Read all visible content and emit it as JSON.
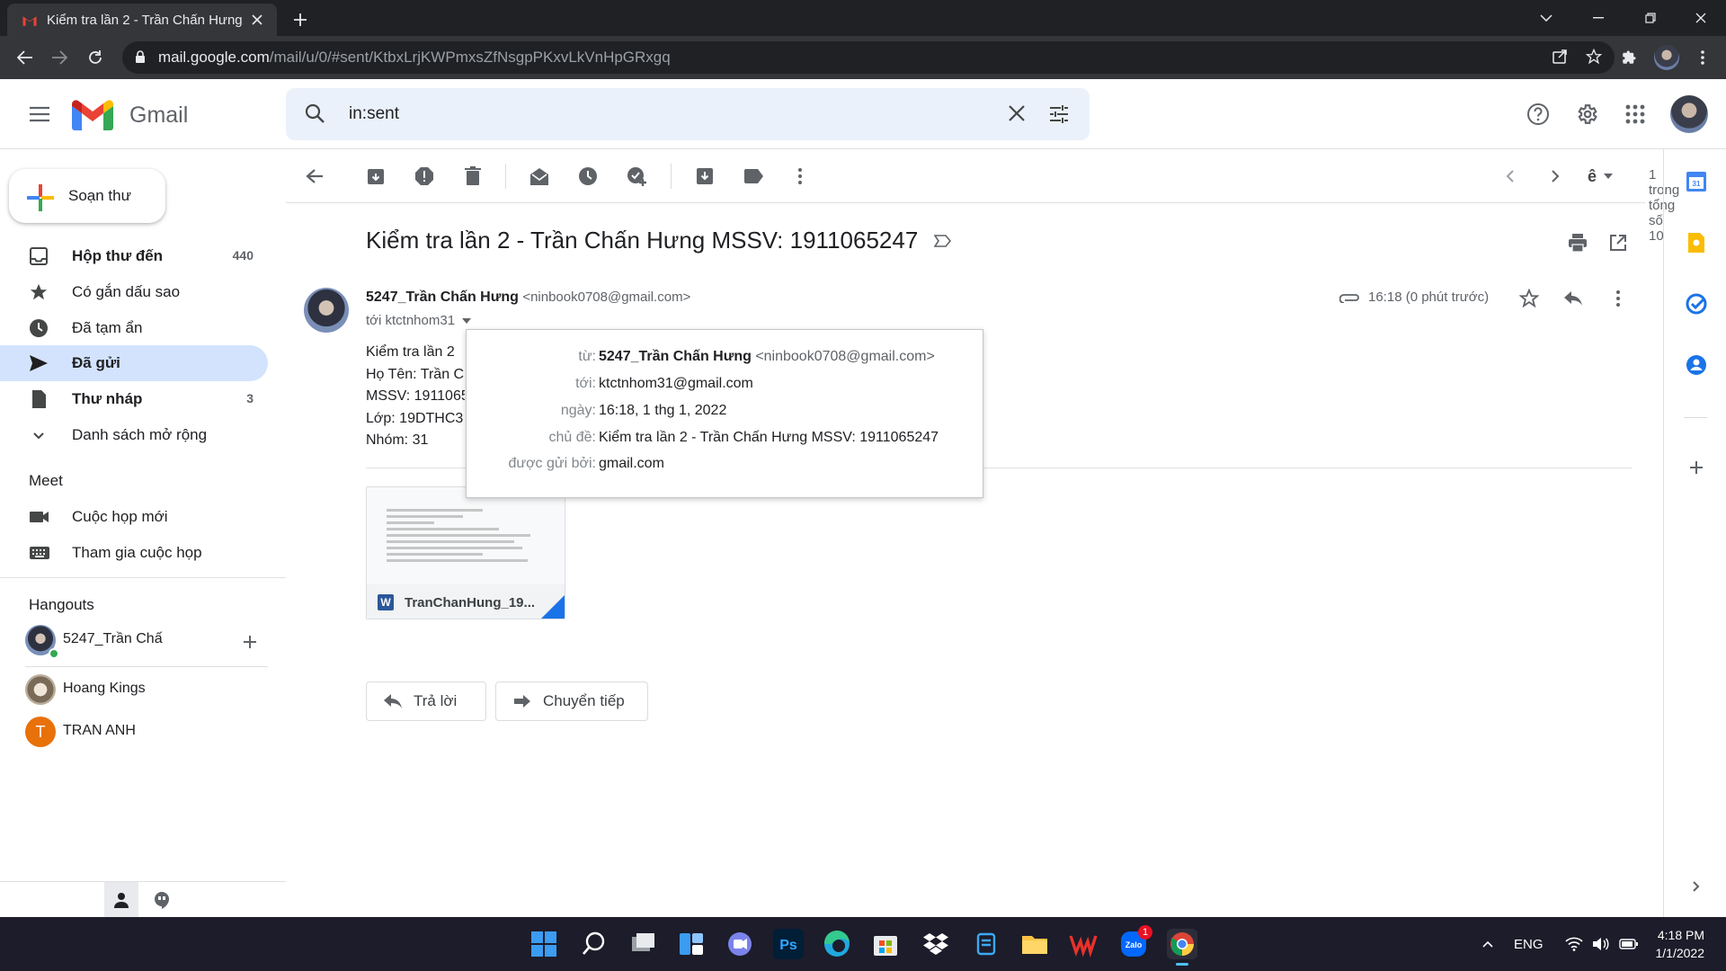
{
  "browser": {
    "tab_title": "Kiểm tra lần 2 - Trần Chấn Hưng",
    "url_host": "mail.google.com",
    "url_path": "/mail/u/0/#sent/KtbxLrjKWPmxsZfNsgpPKxvLkVnHpGRxgq"
  },
  "app": {
    "name": "Gmail"
  },
  "search": {
    "query": "in:sent"
  },
  "sidebar": {
    "compose_label": "Soạn thư",
    "items": [
      {
        "label": "Hộp thư đến",
        "count": "440",
        "icon": "inbox-icon"
      },
      {
        "label": "Có gắn dấu sao",
        "count": "",
        "icon": "star-icon"
      },
      {
        "label": "Đã tạm ẩn",
        "count": "",
        "icon": "clock-icon"
      },
      {
        "label": "Đã gửi",
        "count": "",
        "icon": "send-icon"
      },
      {
        "label": "Thư nháp",
        "count": "3",
        "icon": "draft-icon"
      },
      {
        "label": "Danh sách mở rộng",
        "count": "",
        "icon": "chevron-down-icon"
      }
    ],
    "meet_title": "Meet",
    "meet_items": [
      {
        "label": "Cuộc họp mới",
        "icon": "video-icon"
      },
      {
        "label": "Tham gia cuộc họp",
        "icon": "keyboard-icon"
      }
    ],
    "hangouts_title": "Hangouts",
    "hangouts": [
      {
        "name": "5247_Trần Chấ",
        "initial": ""
      },
      {
        "name": "Hoang Kings",
        "initial": ""
      },
      {
        "name": "TRAN ANH",
        "initial": "T"
      }
    ]
  },
  "toolbar": {
    "pager": "1 trong tổng số 10",
    "input_tool": "ê"
  },
  "email": {
    "subject": "Kiểm tra lần 2 - Trần Chấn Hưng MSSV: 1911065247",
    "sender_name": "5247_Trần Chấn Hưng",
    "sender_email": "<ninbook0708@gmail.com>",
    "to_line": "tới ktctnhom31",
    "time": "16:18 (0 phút trước)",
    "body_lines": [
      "Kiểm tra lần 2",
      "Họ Tên: Trần C",
      "MSSV: 1911065",
      "Lớp: 19DTHC3",
      "Nhóm: 31"
    ],
    "attachment": {
      "name": "TranChanHung_19...",
      "type_badge": "W"
    },
    "reply_label": "Trả lời",
    "forward_label": "Chuyển tiếp"
  },
  "details_popup": {
    "from_label": "từ:",
    "from_name": "5247_Trần Chấn Hưng",
    "from_email": "<ninbook0708@gmail.com>",
    "to_label": "tới:",
    "to_value": "ktctnhom31@gmail.com",
    "date_label": "ngày:",
    "date_value": "16:18, 1 thg 1, 2022",
    "subject_label": "chủ đề:",
    "subject_value": "Kiểm tra lần 2 - Trần Chấn Hưng MSSV: 1911065247",
    "mailedby_label": "được gửi bởi:",
    "mailedby_value": "gmail.com"
  },
  "taskbar": {
    "lang": "ENG",
    "time": "4:18 PM",
    "date": "1/1/2022",
    "zalo_badge": "1"
  },
  "colors": {
    "accent": "#1a73e8",
    "active_nav": "#d3e3fd",
    "search_bg": "#eaf1fb"
  }
}
